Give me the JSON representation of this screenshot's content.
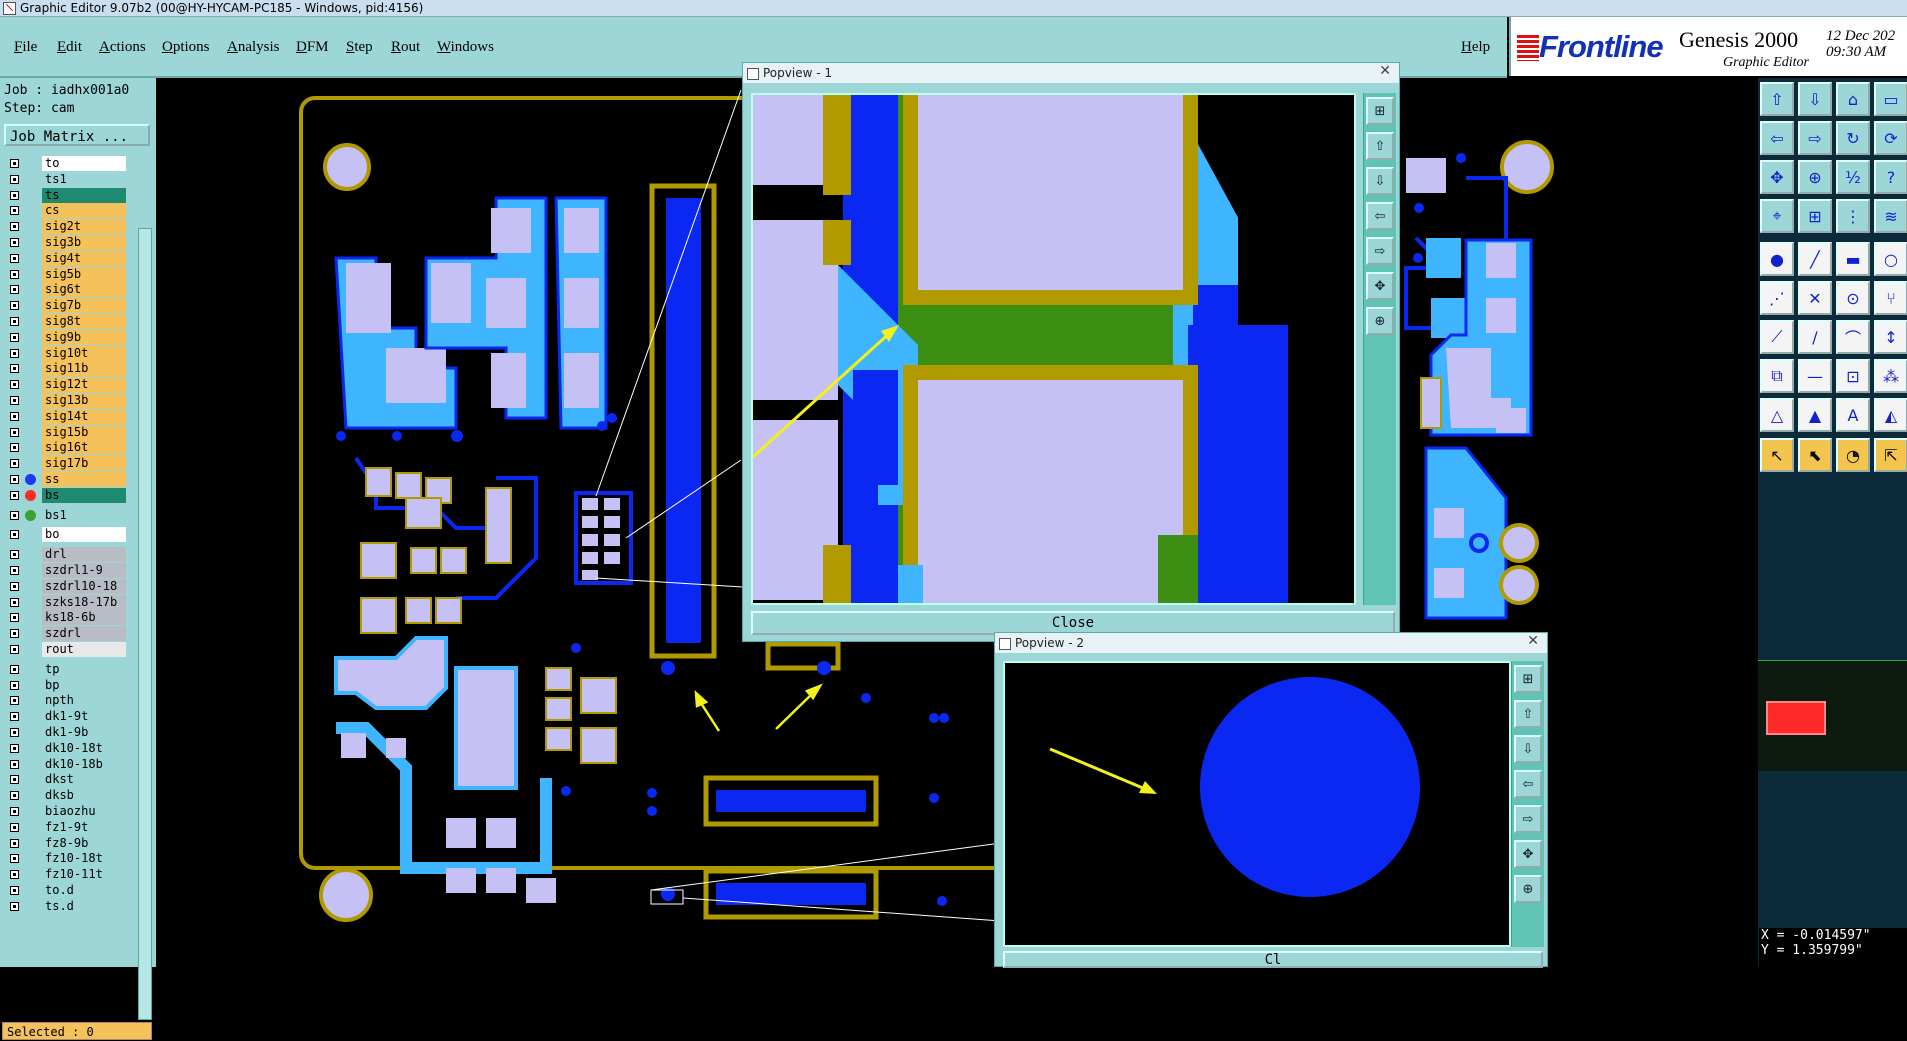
{
  "window": {
    "title": "Graphic Editor 9.07b2 (00@HY-HYCAM-PC185 - Windows, pid:4156)"
  },
  "menu": {
    "items": [
      "File",
      "Edit",
      "Actions",
      "Options",
      "Analysis",
      "DFM",
      "Step",
      "Rout",
      "Windows"
    ],
    "help": "Help"
  },
  "brand": {
    "logo": "Frontline",
    "product": "Genesis 2000",
    "subtitle": "Graphic Editor",
    "date": "12 Dec 202",
    "time": "09:30 AM"
  },
  "job": {
    "job_label": "Job : iadhx001a0",
    "step_label": "Step: cam",
    "matrix_button": "Job Matrix ..."
  },
  "layers": [
    {
      "name": "to",
      "bg": "#ffffff"
    },
    {
      "name": "ts1",
      "bg": "#9dd6d6"
    },
    {
      "name": "ts",
      "bg": "#1e8a70",
      "dot": ""
    },
    {
      "name": "cs",
      "bg": "#f5c15a"
    },
    {
      "name": "sig2t",
      "bg": "#f5c15a"
    },
    {
      "name": "sig3b",
      "bg": "#f5c15a"
    },
    {
      "name": "sig4t",
      "bg": "#f5c15a"
    },
    {
      "name": "sig5b",
      "bg": "#f5c15a"
    },
    {
      "name": "sig6t",
      "bg": "#f5c15a"
    },
    {
      "name": "sig7b",
      "bg": "#f5c15a"
    },
    {
      "name": "sig8t",
      "bg": "#f5c15a"
    },
    {
      "name": "sig9b",
      "bg": "#f5c15a"
    },
    {
      "name": "sig10t",
      "bg": "#f5c15a"
    },
    {
      "name": "sig11b",
      "bg": "#f5c15a"
    },
    {
      "name": "sig12t",
      "bg": "#f5c15a"
    },
    {
      "name": "sig13b",
      "bg": "#f5c15a"
    },
    {
      "name": "sig14t",
      "bg": "#f5c15a"
    },
    {
      "name": "sig15b",
      "bg": "#f5c15a"
    },
    {
      "name": "sig16t",
      "bg": "#f5c15a"
    },
    {
      "name": "sig17b",
      "bg": "#f5c15a"
    },
    {
      "name": "ss",
      "bg": "#f5c15a",
      "dot": "#1b39ff"
    },
    {
      "name": "bs",
      "bg": "#1e8a70",
      "dot": "#ff2a2a"
    },
    {
      "name": "bs1",
      "bg": "#9dd6d6",
      "dot": "#3aa030"
    },
    {
      "name": "bo",
      "bg": "#ffffff"
    },
    {
      "name": "drl",
      "bg": "#b8bcc4"
    },
    {
      "name": "szdrl1-9",
      "bg": "#b8bcc4"
    },
    {
      "name": "szdrl10-18",
      "bg": "#b8bcc4"
    },
    {
      "name": "szks18-17b",
      "bg": "#b8bcc4"
    },
    {
      "name": "ks18-6b",
      "bg": "#b8bcc4"
    },
    {
      "name": "szdrl",
      "bg": "#b8bcc4"
    },
    {
      "name": "rout",
      "bg": "#e8e8e8"
    },
    {
      "name": "tp",
      "bg": "#9dd6d6"
    },
    {
      "name": "bp",
      "bg": "#9dd6d6"
    },
    {
      "name": "npth",
      "bg": "#9dd6d6"
    },
    {
      "name": "dk1-9t",
      "bg": "#9dd6d6"
    },
    {
      "name": "dk1-9b",
      "bg": "#9dd6d6"
    },
    {
      "name": "dk10-18t",
      "bg": "#9dd6d6"
    },
    {
      "name": "dk10-18b",
      "bg": "#9dd6d6"
    },
    {
      "name": "dkst",
      "bg": "#9dd6d6"
    },
    {
      "name": "dksb",
      "bg": "#9dd6d6"
    },
    {
      "name": "biaozhu",
      "bg": "#9dd6d6"
    },
    {
      "name": "fz1-9t",
      "bg": "#9dd6d6"
    },
    {
      "name": "fz8-9b",
      "bg": "#9dd6d6"
    },
    {
      "name": "fz10-18t",
      "bg": "#9dd6d6"
    },
    {
      "name": "fz10-11t",
      "bg": "#9dd6d6"
    },
    {
      "name": "to.d",
      "bg": "#9dd6d6"
    },
    {
      "name": "ts.d",
      "bg": "#9dd6d6"
    }
  ],
  "status": {
    "selected": "Selected : 0",
    "x": "X = -0.014597\"",
    "y": "Y = 1.359799\""
  },
  "popview1": {
    "title": "Popview - 1",
    "close_label": "Close"
  },
  "popview2": {
    "title": "Popview - 2",
    "close_label": "Cl"
  },
  "colors": {
    "pad": "#c6c1f4",
    "copper": "#0b28f2",
    "mask": "#3fb4ff",
    "outline": "#b09a00",
    "green": "#3c8f12",
    "arrow": "#f2f21a"
  }
}
